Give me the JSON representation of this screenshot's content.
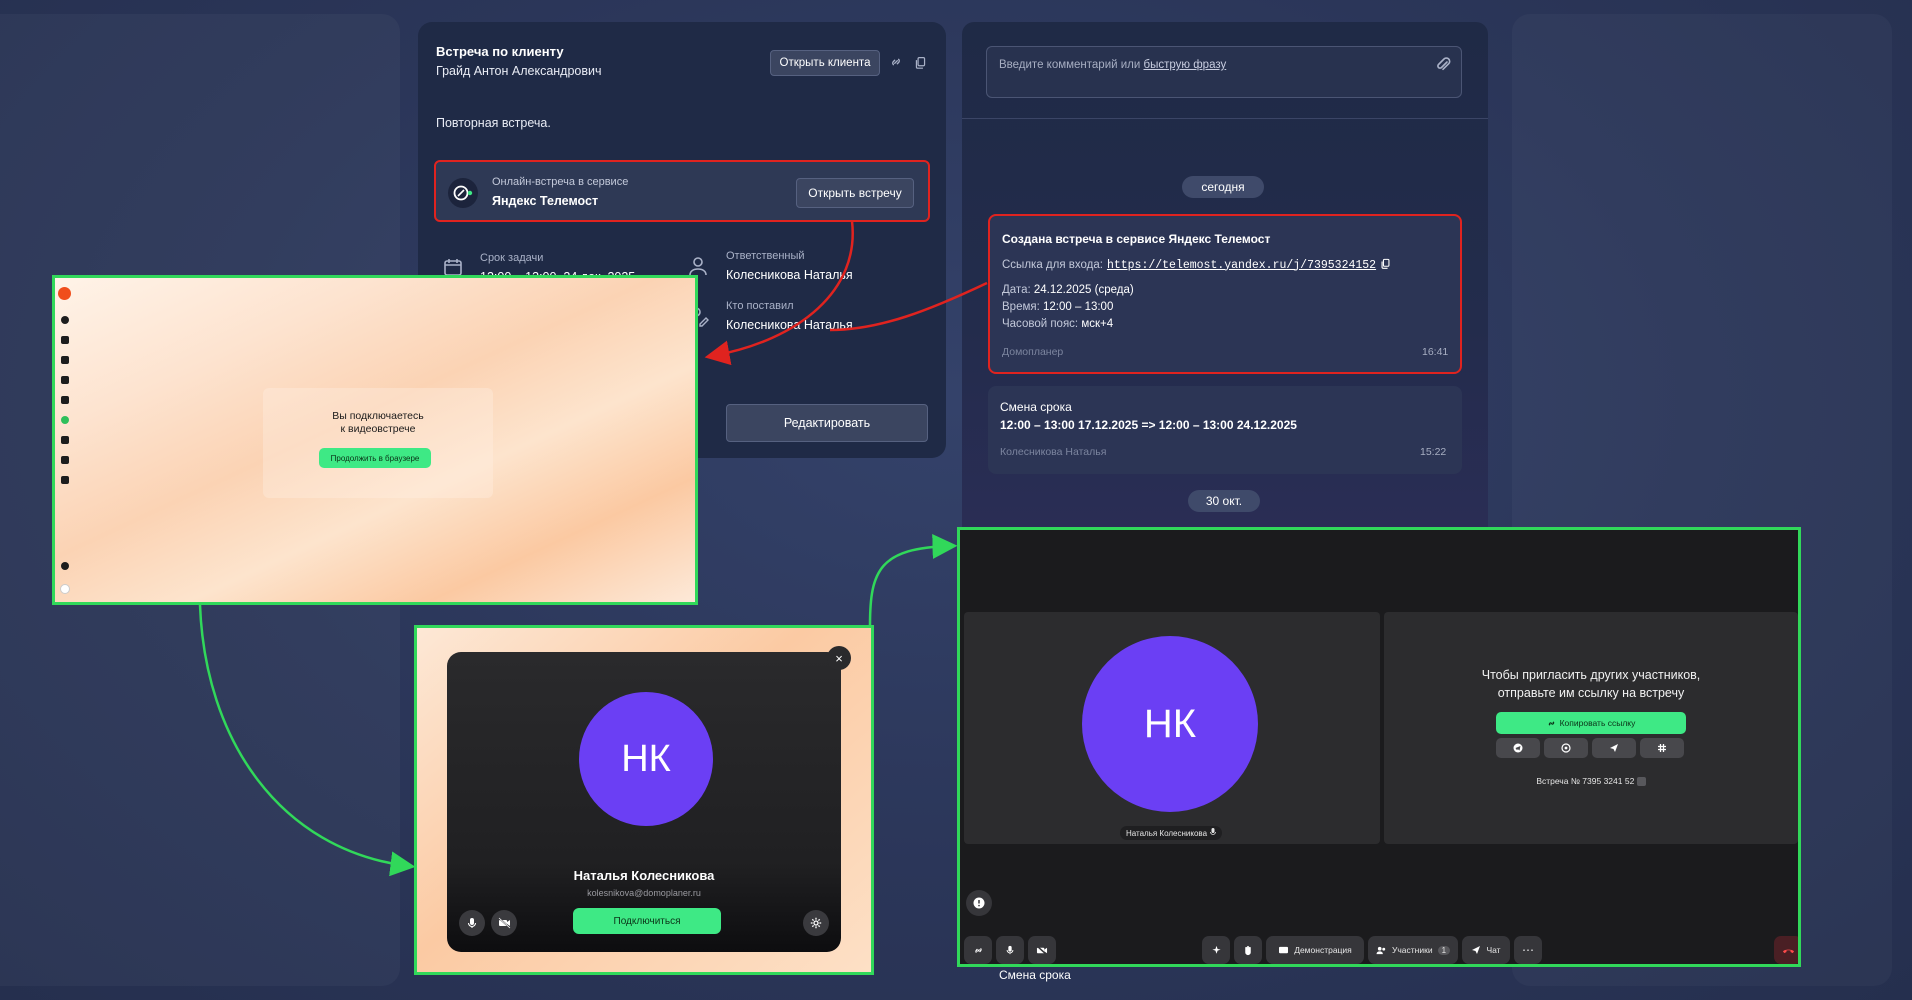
{
  "task": {
    "title": "Встреча по клиенту",
    "client_name": "Грайд Антон Александрович",
    "open_client_label": "Открыть клиента",
    "description": "Повторная встреча.",
    "meeting": {
      "service_label": "Онлайн-встреча в сервисе",
      "service_name": "Яндекс Телемост",
      "open_meeting_label": "Открыть встречу"
    },
    "fields": {
      "deadline_label": "Срок задачи",
      "deadline_value": "12:00 – 13:00, 24 дек. 2025",
      "responsible_label": "Ответственный",
      "responsible_value": "Колесникова Наталья",
      "creator_label": "Кто поставил",
      "creator_value": "Колесникова Наталья"
    },
    "edit_label": "Редактировать"
  },
  "comments": {
    "placeholder_prefix": "Введите комментарий или ",
    "placeholder_link": "быструю фразу",
    "today_label": "сегодня",
    "message1": {
      "title": "Создана встреча в сервисе Яндекс Телемост",
      "link_label": "Ссылка для входа:",
      "link_url": "https://telemost.yandex.ru/j/7395324152",
      "date_label": "Дата:",
      "date_value": "24.12.2025 (среда)",
      "time_label": "Время:",
      "time_value": "12:00 – 13:00",
      "tz_label": "Часовой пояс:",
      "tz_value": "мск+4",
      "source": "Домопланер",
      "time": "16:41"
    },
    "message2": {
      "title": "Смена срока",
      "body": "12:00 – 13:00 17.12.2025 => 12:00 – 13:00 24.12.2025",
      "author": "Колесникова Наталья",
      "time": "15:22"
    },
    "oct_label": "30 окт.",
    "below_label": "Смена срока"
  },
  "browser": {
    "connecting_text_1": "Вы подключаетесь",
    "connecting_text_2": "к видеовстрече",
    "continue_label": "Продолжить в браузере"
  },
  "join": {
    "initials": "НК",
    "name": "Наталья Колесникова",
    "email": "kolesnikova@domoplaner.ru",
    "connect_label": "Подключиться",
    "close_symbol": "×"
  },
  "call": {
    "initials": "НК",
    "participant_name": "Наталья Колесникова",
    "invite_line1": "Чтобы пригласить других участников,",
    "invite_line2": "отправьте им ссылку на встречу",
    "copy_link_label": "Копировать ссылку",
    "meeting_number": "Встреча № 7395 3241 52",
    "toolbar": {
      "demo_label": "Демонстрация",
      "participants_label": "Участники",
      "participants_count": "1",
      "chat_label": "Чат",
      "more_label": "⋯"
    }
  },
  "colors": {
    "background": "#2b3659",
    "card": "#1f2a46",
    "highlight_red": "#e0231f",
    "highlight_green": "#31d85a",
    "accent_green": "#3ee985",
    "avatar_purple": "#6b3ff4"
  }
}
